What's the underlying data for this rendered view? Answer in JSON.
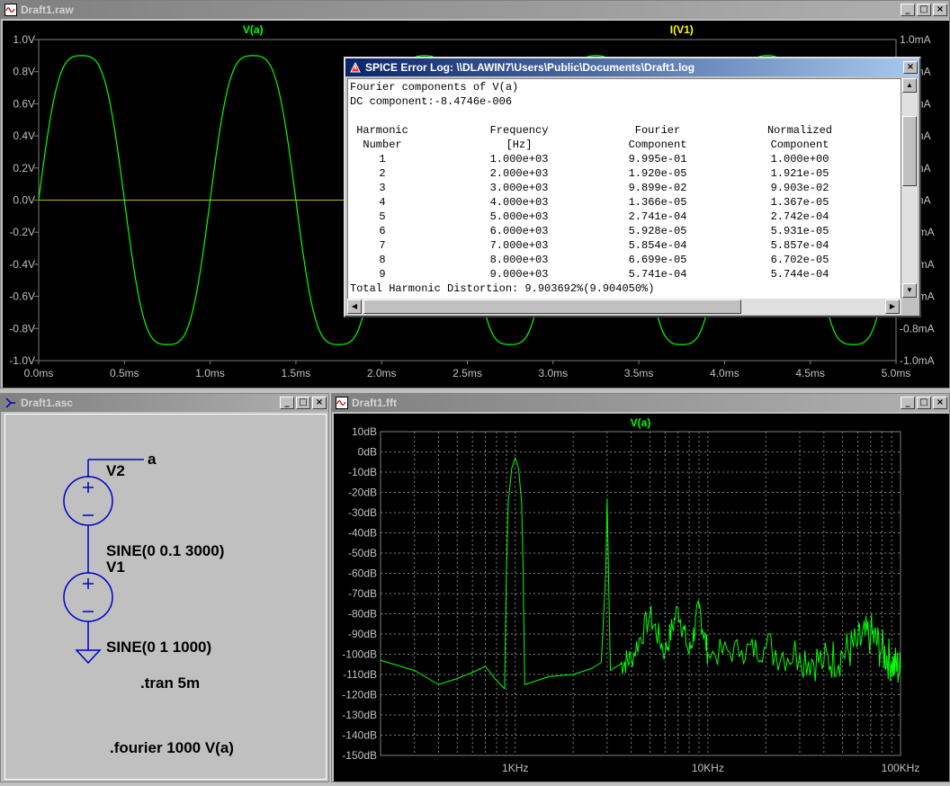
{
  "raw_window": {
    "title": "Draft1.raw",
    "trace_left": "V(a)",
    "trace_right": "I(V1)",
    "left_ticks": [
      "1.0V",
      "0.8V",
      "0.6V",
      "0.4V",
      "0.2V",
      "0.0V",
      "-0.2V",
      "-0.4V",
      "-0.6V",
      "-0.8V",
      "-1.0V"
    ],
    "right_ticks": [
      "1.0mA",
      "0.8mA",
      "0.6mA",
      "0.4mA",
      "0.2mA",
      "0.0mA",
      "-0.2mA",
      "-0.4mA",
      "-0.6mA",
      "-0.8mA",
      "-1.0mA"
    ],
    "x_ticks": [
      "0.0ms",
      "0.5ms",
      "1.0ms",
      "1.5ms",
      "2.0ms",
      "2.5ms",
      "3.0ms",
      "3.5ms",
      "4.0ms",
      "4.5ms",
      "5.0ms"
    ],
    "trace_color": "#00ff00"
  },
  "chart_data": [
    {
      "type": "line",
      "title": "V(a)",
      "xlabel": "",
      "ylabel": "",
      "x_range_ms": [
        0,
        5
      ],
      "ylim": [
        -1.0,
        1.0
      ],
      "y2_label": "I(V1)",
      "y2lim_mA": [
        -1.0,
        1.0
      ],
      "grid": true,
      "series": [
        {
          "name": "V(a)",
          "description_formula": "y = sin(2*pi*1000*t) + 0.1*sin(2*pi*3000*t)",
          "peak_v": 0.9,
          "trough_v": -0.9
        }
      ]
    },
    {
      "type": "line",
      "title": "V(a)",
      "xlabel": "",
      "ylabel": "",
      "x_ticks": [
        "1KHz",
        "10KHz",
        "100KHz"
      ],
      "x_log": true,
      "x_range_hz": [
        200,
        100000
      ],
      "ylim_db": [
        -150,
        10
      ],
      "grid": true,
      "series": [
        {
          "name": "V(a)",
          "points_hz_db": [
            [
              200,
              -103
            ],
            [
              300,
              -108
            ],
            [
              400,
              -115
            ],
            [
              500,
              -112
            ],
            [
              600,
              -109
            ],
            [
              700,
              -106
            ],
            [
              800,
              -113
            ],
            [
              880,
              -117
            ],
            [
              900,
              -60
            ],
            [
              920,
              -25
            ],
            [
              960,
              -8
            ],
            [
              1000,
              -3
            ],
            [
              1040,
              -8
            ],
            [
              1080,
              -25
            ],
            [
              1100,
              -60
            ],
            [
              1120,
              -115
            ],
            [
              1500,
              -111
            ],
            [
              2000,
              -110
            ],
            [
              2500,
              -107
            ],
            [
              2800,
              -104
            ],
            [
              2950,
              -60
            ],
            [
              3000,
              -23
            ],
            [
              3050,
              -60
            ],
            [
              3120,
              -108
            ],
            [
              3500,
              -105
            ],
            [
              4000,
              -102
            ],
            [
              5000,
              -81
            ],
            [
              6000,
              -99
            ],
            [
              7000,
              -77
            ],
            [
              8000,
              -100
            ],
            [
              9000,
              -77
            ],
            [
              10000,
              -100
            ],
            [
              15000,
              -98
            ],
            [
              20000,
              -97
            ],
            [
              30000,
              -100
            ],
            [
              40000,
              -104
            ],
            [
              50000,
              -100
            ],
            [
              60000,
              -95
            ],
            [
              70000,
              -90
            ],
            [
              80000,
              -98
            ],
            [
              90000,
              -104
            ],
            [
              100000,
              -108
            ]
          ]
        }
      ]
    }
  ],
  "log_window": {
    "title": "SPICE Error Log: \\\\DLAWIN7\\Users\\Public\\Documents\\Draft1.log",
    "line1": "Fourier components of V(a)",
    "line2": "DC component:-8.4746e-006",
    "headers_top": [
      "Harmonic",
      "Frequency",
      "Fourier",
      "Normalized"
    ],
    "headers_bottom": [
      "Number",
      "[Hz]",
      "Component",
      "Component"
    ],
    "rows": [
      [
        "1",
        "1.000e+03",
        "9.995e-01",
        "1.000e+00"
      ],
      [
        "2",
        "2.000e+03",
        "1.920e-05",
        "1.921e-05"
      ],
      [
        "3",
        "3.000e+03",
        "9.899e-02",
        "9.903e-02"
      ],
      [
        "4",
        "4.000e+03",
        "1.366e-05",
        "1.367e-05"
      ],
      [
        "5",
        "5.000e+03",
        "2.741e-04",
        "2.742e-04"
      ],
      [
        "6",
        "6.000e+03",
        "5.928e-05",
        "5.931e-05"
      ],
      [
        "7",
        "7.000e+03",
        "5.854e-04",
        "5.857e-04"
      ],
      [
        "8",
        "8.000e+03",
        "6.699e-05",
        "6.702e-05"
      ],
      [
        "9",
        "9.000e+03",
        "5.741e-04",
        "5.744e-04"
      ]
    ],
    "thd": "Total Harmonic Distortion: 9.903692%(9.904050%)"
  },
  "asc_window": {
    "title": "Draft1.asc",
    "net_label": "a",
    "v2_name": "V2",
    "v2_value": "SINE(0 0.1 3000)",
    "v1_name": "V1",
    "v1_value": "SINE(0 1 1000)",
    "tran_cmd": ".tran 5m",
    "fourier_cmd": ".fourier 1000 V(a)"
  },
  "fft_window": {
    "title": "Draft1.fft",
    "trace": "V(a)",
    "y_ticks": [
      "10dB",
      "0dB",
      "-10dB",
      "-20dB",
      "-30dB",
      "-40dB",
      "-50dB",
      "-60dB",
      "-70dB",
      "-80dB",
      "-90dB",
      "-100dB",
      "-110dB",
      "-120dB",
      "-130dB",
      "-140dB",
      "-150dB"
    ],
    "x_ticks": [
      "1KHz",
      "10KHz",
      "100KHz"
    ]
  },
  "window_buttons": {
    "minimize": "_",
    "maximize": "□",
    "close": "×"
  }
}
